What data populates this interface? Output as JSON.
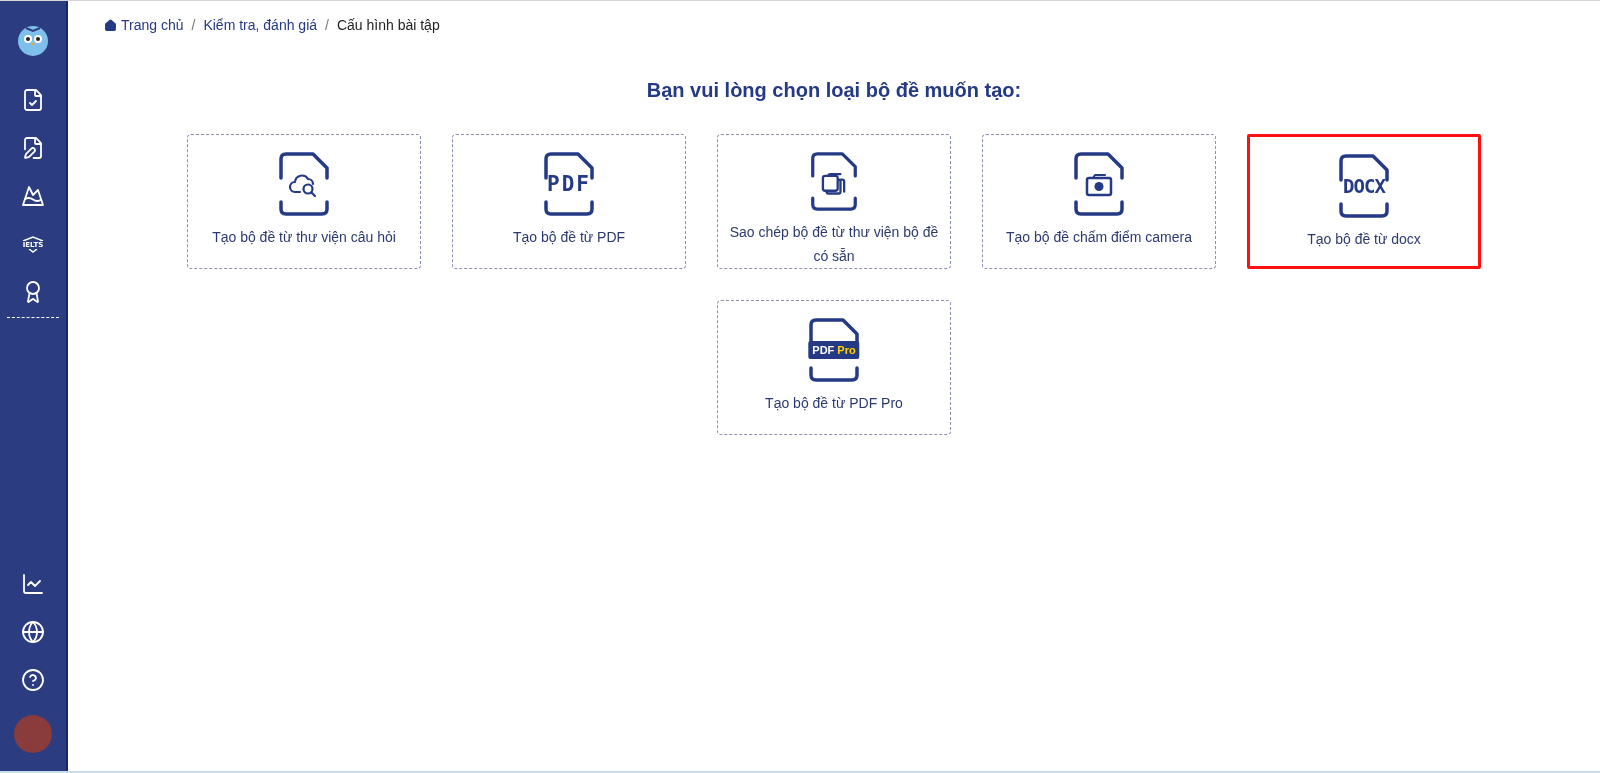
{
  "sidebar": {
    "top_items": [
      {
        "kind": "logo"
      },
      {
        "kind": "exam-check"
      },
      {
        "kind": "exam-edit"
      },
      {
        "kind": "mountain"
      },
      {
        "kind": "ielts",
        "label": "IELTS"
      },
      {
        "kind": "certificate"
      }
    ],
    "bottom_items": [
      {
        "kind": "chart"
      },
      {
        "kind": "globe"
      },
      {
        "kind": "help"
      },
      {
        "kind": "avatar"
      }
    ]
  },
  "breadcrumb": [
    {
      "label": "Trang chủ",
      "home": true,
      "current": false
    },
    {
      "label": "Kiểm tra, đánh giá",
      "home": false,
      "current": false,
      "separator": "/"
    },
    {
      "label": "Cấu hình bài tập",
      "home": false,
      "current": true,
      "separator": "/"
    }
  ],
  "heading": "Bạn vui lòng chọn loại bộ đề muốn tạo:",
  "card_rows": [
    [
      {
        "kind": "library",
        "label": "Tạo bộ đề từ thư viện câu hỏi",
        "selected": false
      },
      {
        "kind": "pdf",
        "icon_text": "PDF",
        "label": "Tạo bộ đề từ PDF",
        "selected": false
      },
      {
        "kind": "copy",
        "label": "Sao chép bộ đề từ thư viện bộ đề có sẵn",
        "selected": false
      },
      {
        "kind": "camera",
        "label": "Tạo bộ đề chấm điểm camera",
        "selected": false
      },
      {
        "kind": "docx",
        "icon_text": "DOCX",
        "label": "Tạo bộ đề từ docx",
        "selected": true
      }
    ],
    [
      {
        "kind": "pdfpro",
        "icon_text": "PDF",
        "icon_text_extra": "Pro",
        "label": "Tạo bộ đề từ PDF Pro",
        "selected": false
      }
    ]
  ]
}
